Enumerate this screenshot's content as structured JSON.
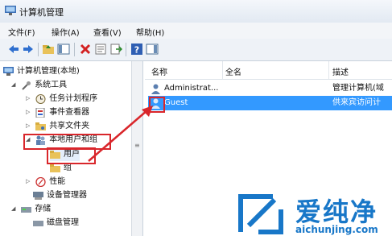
{
  "window": {
    "title": "计算机管理"
  },
  "menu": [
    {
      "label": "文件(F)"
    },
    {
      "label": "操作(A)"
    },
    {
      "label": "查看(V)"
    },
    {
      "label": "帮助(H)"
    }
  ],
  "toolbar": {
    "icons": [
      "back-arrow-icon",
      "forward-arrow-icon",
      "up-folder-icon",
      "show-hide-tree-icon",
      "delete-icon",
      "properties-icon",
      "export-list-icon",
      "help-icon",
      "show-action-pane-icon"
    ]
  },
  "tree": {
    "items": [
      {
        "label": "计算机管理(本地)",
        "icon": "computer-management-icon"
      },
      {
        "label": "系统工具",
        "icon": "tools-icon",
        "expander": "◢"
      },
      {
        "label": "任务计划程序",
        "icon": "clock-icon",
        "expander": "▷"
      },
      {
        "label": "事件查看器",
        "icon": "event-viewer-icon",
        "expander": "▷"
      },
      {
        "label": "共享文件夹",
        "icon": "shared-folder-icon",
        "expander": "▷"
      },
      {
        "label": "本地用户和组",
        "icon": "users-group-icon",
        "expander": "◢"
      },
      {
        "label": "用户",
        "icon": "folder-icon"
      },
      {
        "label": "组",
        "icon": "folder-icon"
      },
      {
        "label": "性能",
        "icon": "performance-icon",
        "expander": "▷"
      },
      {
        "label": "设备管理器",
        "icon": "device-manager-icon"
      },
      {
        "label": "存储",
        "icon": "storage-icon",
        "expander": "◢"
      },
      {
        "label": "磁盘管理",
        "icon": "disk-icon"
      }
    ]
  },
  "list": {
    "columns": [
      "名称",
      "全名",
      "描述"
    ],
    "rows": [
      {
        "name": "Administrat...",
        "fullname": "",
        "description": "管理计算机(域",
        "selected": false
      },
      {
        "name": "Guest",
        "fullname": "",
        "description": "供来宾访问计",
        "selected": true
      }
    ]
  },
  "watermark": {
    "brand": "爱纯净",
    "url": "aichunjing.com"
  },
  "colors": {
    "selection": "#3399ff",
    "highlight_box": "#d9262b",
    "brand_blue": "#1877c8"
  }
}
